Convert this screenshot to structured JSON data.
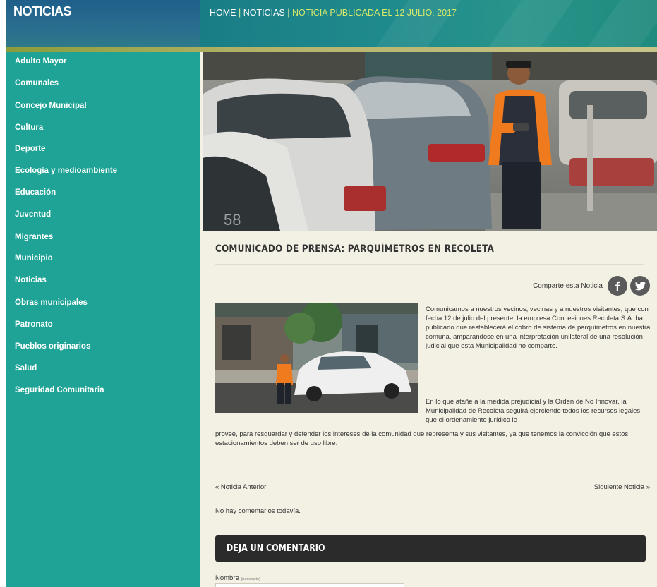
{
  "section_title": "NOTICIAS",
  "breadcrumb": {
    "home": "HOME",
    "sep1": " | ",
    "noticias": "NOTICIAS",
    "sep2": " | ",
    "current": "NOTICIA PUBLICADA EL 12 JULIO, 2017"
  },
  "sidebar": {
    "items": [
      {
        "label": "Adulto Mayor"
      },
      {
        "label": "Comunales"
      },
      {
        "label": "Concejo Municipal"
      },
      {
        "label": "Cultura"
      },
      {
        "label": "Deporte"
      },
      {
        "label": "Ecología y medioambiente"
      },
      {
        "label": "Educación"
      },
      {
        "label": "Juventud"
      },
      {
        "label": "Migrantes"
      },
      {
        "label": "Municipio"
      },
      {
        "label": "Noticias"
      },
      {
        "label": "Obras municipales"
      },
      {
        "label": "Patronato"
      },
      {
        "label": "Pueblos originarios"
      },
      {
        "label": "Salud"
      },
      {
        "label": "Seguridad Comunitaria"
      }
    ]
  },
  "article": {
    "title": "COMUNICADO DE PRENSA: PARQUÍMETROS EN RECOLETA",
    "share_label": "Comparte esta Noticia",
    "paragraph1": "Comunicamos a nuestros vecinos, vecinas y a nuestros visitantes, que con fecha 12 de julio del presente, la empresa Concesiones Recoleta S.A. ha publicado que restablecerá el cobro de sistema de parquímetros en nuestra comuna, amparándose en una interpretación unilateral de una resolución judicial que esta Municipalidad no comparte.",
    "paragraph2_top": "En lo que atañe a la medida prejudicial y la Orden de No Innovar, la Municipalidad de Recoleta seguirá ejerciendo todos los recursos legales que el ordenamiento jurídico le",
    "paragraph2_bottom": "provee, para resguardar y defender los intereses de la comunidad que representa y sus visitantes, ya que tenemos la convicción que estos estacionamientos deben ser de uso libre."
  },
  "nav": {
    "prev": "« Noticia Anterior",
    "next": "Siguiente Noticia »"
  },
  "comments": {
    "empty": "No hay comentarios todavía.",
    "heading": "DEJA UN COMENTARIO",
    "name_label": "Nombre",
    "name_required": "(necesario)",
    "name_value": ""
  },
  "colors": {
    "sidebar": "#1fa396",
    "header": "#1f5f8a",
    "breadcrumb_current": "#d4e86a",
    "content_bg": "#f3f0e4",
    "comment_bar": "#2b2b2b"
  },
  "icons": {
    "share_facebook": "facebook-icon",
    "share_twitter": "twitter-icon"
  }
}
